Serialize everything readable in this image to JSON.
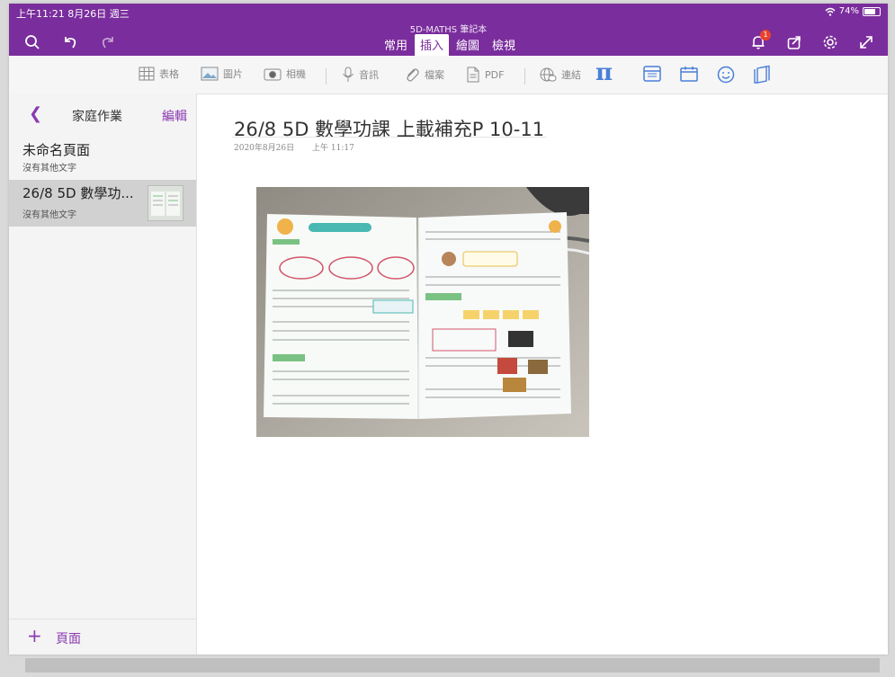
{
  "status_bar": {
    "time": "上午11:21  8月26日 週三",
    "battery": "74%",
    "battery_fraction": 0.74
  },
  "notebook_title": "5D-MATHS 筆記本",
  "toolbar_left": {
    "icons": [
      "search-icon",
      "undo-icon",
      "redo-icon"
    ]
  },
  "tabs": [
    {
      "label": "常用",
      "active": false
    },
    {
      "label": "插入",
      "active": true
    },
    {
      "label": "繪圖",
      "active": false
    },
    {
      "label": "檢視",
      "active": false
    }
  ],
  "toolbar_right": {
    "icons": [
      "notification-bell-icon",
      "share-icon",
      "settings-gear-icon",
      "expand-icon"
    ],
    "notification_count": "1"
  },
  "ribbon": {
    "table": "表格",
    "picture": "圖片",
    "camera": "相機",
    "audio": "音訊",
    "file": "檔案",
    "pdf": "PDF",
    "link": "連結",
    "math_symbol": "π"
  },
  "sidebar": {
    "section_name": "家庭作業",
    "edit_label": "編輯",
    "pages": [
      {
        "title": "未命名頁面",
        "subtitle": "沒有其他文字",
        "selected": false
      },
      {
        "title": "26/8 5D 數學功...",
        "subtitle": "沒有其他文字",
        "selected": true
      }
    ],
    "add_page_label": "頁面"
  },
  "page": {
    "title": "26/8 5D 數學功課 上載補充P 10-11",
    "date": "2020年8月26日",
    "time": "上午 11:17"
  },
  "colors": {
    "accent": "#7a2d9c",
    "accent_light": "#8a3ab0",
    "ribbon_blue": "#4a7fd8"
  }
}
